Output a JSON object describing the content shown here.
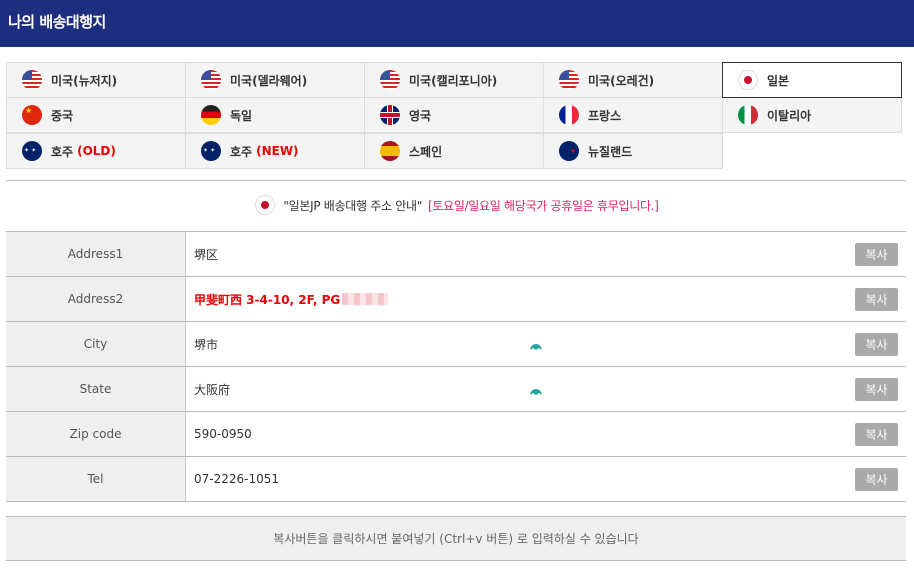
{
  "header": {
    "title": "나의 배송대행지"
  },
  "countries": {
    "row1": [
      {
        "label": "미국(뉴저지)",
        "flag": "us-flag-icon",
        "suffix": ""
      },
      {
        "label": "미국(델라웨어)",
        "flag": "us-flag-icon",
        "suffix": ""
      },
      {
        "label": "미국(캘리포니아)",
        "flag": "us-flag-icon",
        "suffix": ""
      },
      {
        "label": "미국(오레건)",
        "flag": "us-flag-icon",
        "suffix": ""
      },
      {
        "label": "일본",
        "flag": "jp-flag-icon",
        "suffix": "",
        "active": true
      }
    ],
    "row2": [
      {
        "label": "중국",
        "flag": "cn-flag-icon",
        "suffix": ""
      },
      {
        "label": "독일",
        "flag": "de-flag-icon",
        "suffix": ""
      },
      {
        "label": "영국",
        "flag": "uk-flag-icon",
        "suffix": ""
      },
      {
        "label": "프랑스",
        "flag": "fr-flag-icon",
        "suffix": ""
      },
      {
        "label": "이탈리아",
        "flag": "it-flag-icon",
        "suffix": ""
      }
    ],
    "row3": [
      {
        "label": "호주",
        "flag": "au-flag-icon",
        "suffix": "(OLD)"
      },
      {
        "label": "호주",
        "flag": "au-flag-icon",
        "suffix": "(NEW)"
      },
      {
        "label": "스페인",
        "flag": "es-flag-icon",
        "suffix": ""
      },
      {
        "label": "뉴질랜드",
        "flag": "nz-flag-icon",
        "suffix": ""
      }
    ]
  },
  "notice": {
    "title": "\"일본JP  배송대행 주소 안내\"",
    "holiday": "[토요일/일요일 해당국가 공휴일은 휴무입니다.]"
  },
  "address": {
    "copy_label": "복사",
    "rows": [
      {
        "label": "Address1",
        "value": "堺区"
      },
      {
        "label": "Address2",
        "value": "甲斐町西 3-4-10, 2F, PG"
      },
      {
        "label": "City",
        "value": "堺市"
      },
      {
        "label": "State",
        "value": "大阪府"
      },
      {
        "label": "Zip code",
        "value": "590-0950"
      },
      {
        "label": "Tel",
        "value": "07-2226-1051"
      }
    ]
  },
  "footer": {
    "note": "복사버튼을 클릭하시면 붙여넣기 (Ctrl+v 버튼) 로 입력하실 수 있습니다"
  },
  "colors": {
    "header_bg": "#1d2e7e",
    "accent_red": "#e00000",
    "notice_pink": "#e0245e",
    "copy_btn": "#aaaaaa"
  }
}
